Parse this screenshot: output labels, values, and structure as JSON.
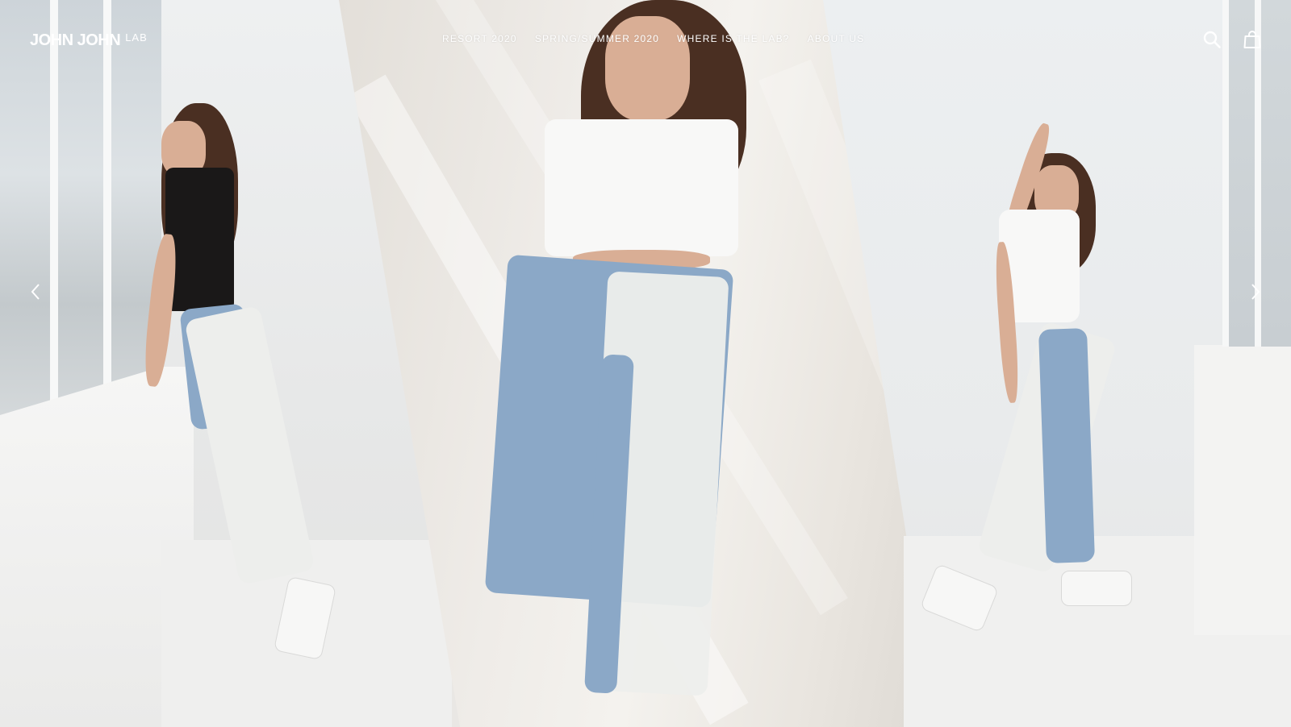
{
  "header": {
    "logo_main": "JOHN JOHN",
    "logo_sub": "LAB",
    "nav": [
      {
        "label": "RESORT 2020"
      },
      {
        "label": "SPRING/SUMMER 2020"
      },
      {
        "label": "WHERE IS THE LAB?"
      },
      {
        "label": "ABOUT US"
      }
    ],
    "icons": {
      "search": "search-icon",
      "cart": "shopping-bag-icon"
    }
  },
  "hero": {
    "images": [
      "model in black tee and two-tone jeans leaning on window sill",
      "model in white crop tee and split-dye jeans against wall",
      "model in white tee and two-tone jeans posing in white room"
    ],
    "prev_icon": "chevron-left-icon",
    "next_icon": "chevron-right-icon"
  },
  "colors": {
    "header_text": "#ffffff",
    "background": "#e9e7e4"
  }
}
